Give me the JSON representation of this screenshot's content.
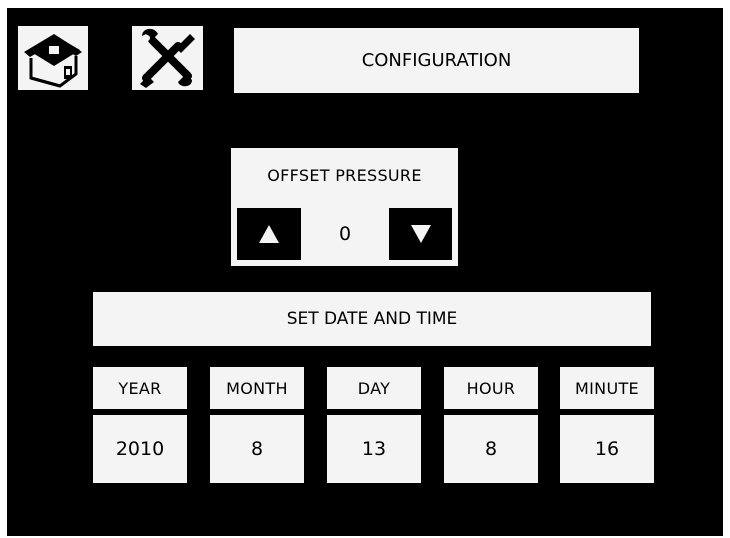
{
  "header": {
    "home_icon": "home-icon",
    "tools_icon": "tools-icon",
    "title": "CONFIGURATION"
  },
  "offset_pressure": {
    "label": "OFFSET PRESSURE",
    "value": "0",
    "increment_icon": "arrow-up-icon",
    "decrement_icon": "arrow-down-icon"
  },
  "date_time": {
    "label": "SET DATE AND TIME",
    "fields": [
      {
        "label": "YEAR",
        "value": "2010"
      },
      {
        "label": "MONTH",
        "value": "8"
      },
      {
        "label": "DAY",
        "value": "13"
      },
      {
        "label": "HOUR",
        "value": "8"
      },
      {
        "label": "MINUTE",
        "value": "16"
      }
    ]
  },
  "colors": {
    "background": "#000000",
    "panel": "#f4f4f4",
    "text": "#000000"
  }
}
